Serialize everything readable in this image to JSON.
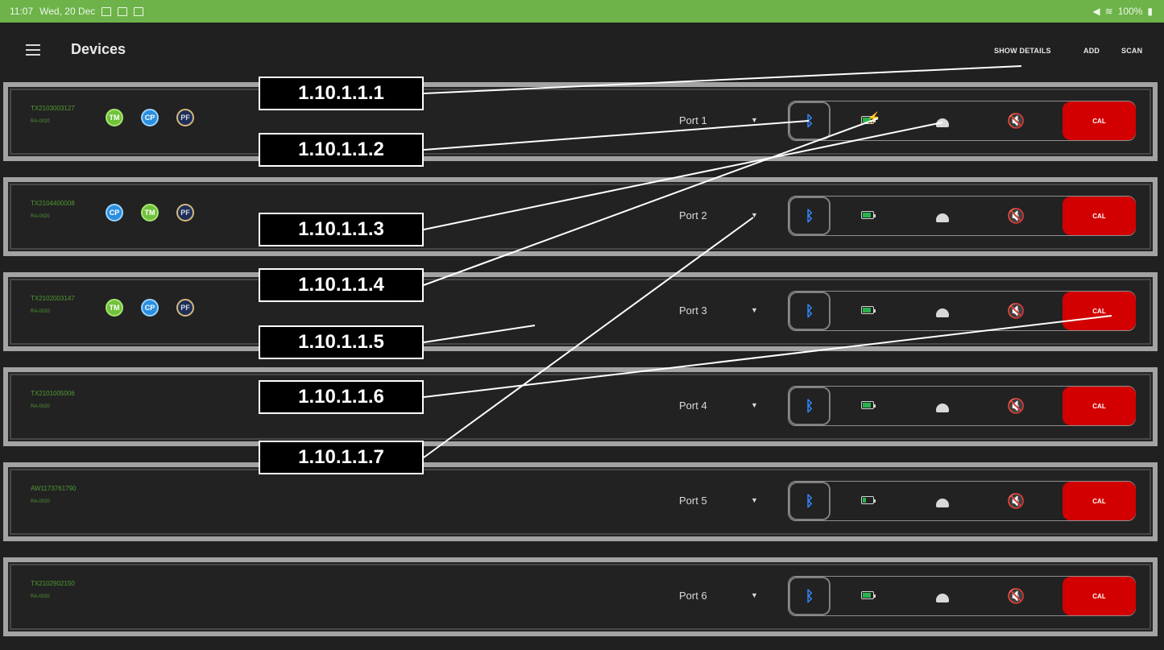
{
  "status_bar": {
    "time": "11:07",
    "date": "Wed, 20 Dec",
    "battery": "100%"
  },
  "app_bar": {
    "title": "Devices",
    "show_details": "SHOW DETAILS",
    "add": "ADD",
    "scan": "SCAN"
  },
  "devices": [
    {
      "serial": "TX2103003127",
      "model": "RA-0020",
      "badges": [
        "TM",
        "CP",
        "PF"
      ],
      "port": "Port 1",
      "battery_state": "charging",
      "cal": "CAL"
    },
    {
      "serial": "TX2104400008",
      "model": "RA-0020",
      "badges": [
        "CP",
        "TM",
        "PF"
      ],
      "port": "Port 2",
      "battery_state": "full",
      "cal": "CAL"
    },
    {
      "serial": "TX2102003147",
      "model": "RA-0020",
      "badges": [
        "TM",
        "CP",
        "PF"
      ],
      "port": "Port 3",
      "battery_state": "full",
      "cal": "CAL"
    },
    {
      "serial": "TX2101005006",
      "model": "RA-0020",
      "badges": [],
      "port": "Port 4",
      "battery_state": "full",
      "cal": "CAL"
    },
    {
      "serial": "AW1173761790",
      "model": "RA-0020",
      "badges": [],
      "port": "Port 5",
      "battery_state": "low",
      "cal": "CAL"
    },
    {
      "serial": "TX2102902150",
      "model": "RA-0020",
      "badges": [],
      "port": "Port 6",
      "battery_state": "full",
      "cal": "CAL"
    }
  ],
  "callouts": [
    "1.10.1.1.1",
    "1.10.1.1.2",
    "1.10.1.1.3",
    "1.10.1.1.4",
    "1.10.1.1.5",
    "1.10.1.1.6",
    "1.10.1.1.7"
  ],
  "icons": {
    "menu": "hamburger-icon",
    "bluetooth": "bluetooth-icon",
    "battery": "battery-icon",
    "hat": "hat-icon",
    "mute": "mute-icon",
    "dropdown": "chevron-down-icon"
  },
  "colors": {
    "status_bar": "#6db34a",
    "background": "#202020",
    "device_border": "#a3a3a3",
    "serial_text": "#4f9a33",
    "bluetooth": "#3187ff",
    "cal_button": "#d20000",
    "battery_fill": "#29b34c"
  }
}
